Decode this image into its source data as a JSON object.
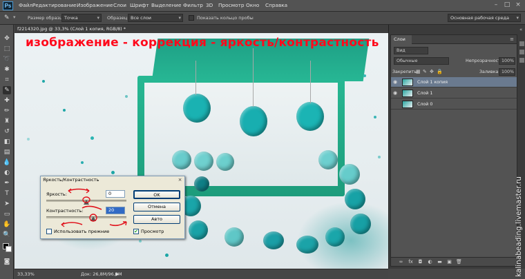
{
  "app": {
    "logo": "Ps",
    "menu": [
      "Файл",
      "Редактирование",
      "Изображение",
      "Слои",
      "Шрифт",
      "Выделение",
      "Фильтр",
      "3D",
      "Просмотр",
      "Окно",
      "Справка"
    ]
  },
  "options": {
    "size_label": "Размер образца:",
    "size_value": "Точка",
    "sample_label": "Образец:",
    "sample_value": "Все слои",
    "show_ring_label": "Показать кольцо пробы",
    "workspace_value": "Основная рабочая среда"
  },
  "document": {
    "tab_label": "f2214320.jpg @ 33,3% (Слой 1 копия, RGB/8) *",
    "overlay_title": "изображение - коррекция - яркость/контрастность"
  },
  "status": {
    "zoom": "33,33%",
    "doc_size": "Док: 26,8M/96,0M"
  },
  "dialog": {
    "title": "Яркость/Контрастность",
    "brightness_label": "Яркость:",
    "brightness_value": "0",
    "contrast_label": "Контрастность:",
    "contrast_value": "20",
    "legacy_label": "Использовать прежние",
    "preview_label": "Просмотр",
    "ok_label": "OK",
    "cancel_label": "Отмена",
    "auto_label": "Авто",
    "legacy_checked": false,
    "preview_checked": true
  },
  "layers_panel": {
    "tab_label": "Слои",
    "filter_value": "Вид",
    "blend_value": "Обычные",
    "opacity_label": "Непрозрачность:",
    "opacity_value": "100%",
    "lock_label": "Закрепить:",
    "fill_label": "Заливка:",
    "fill_value": "100%",
    "layers": [
      {
        "name": "Слой 1 копия",
        "visible": true,
        "selected": true
      },
      {
        "name": "Слой 1",
        "visible": true,
        "selected": false
      },
      {
        "name": "Слой 0",
        "visible": false,
        "selected": false
      }
    ]
  },
  "watermark": "kalinabeading.livemaster.ru",
  "colors": {
    "overlay_red": "#ff0a1c",
    "selected_layer": "#6a7a8f",
    "ps_blue": "#4a9ad6"
  }
}
